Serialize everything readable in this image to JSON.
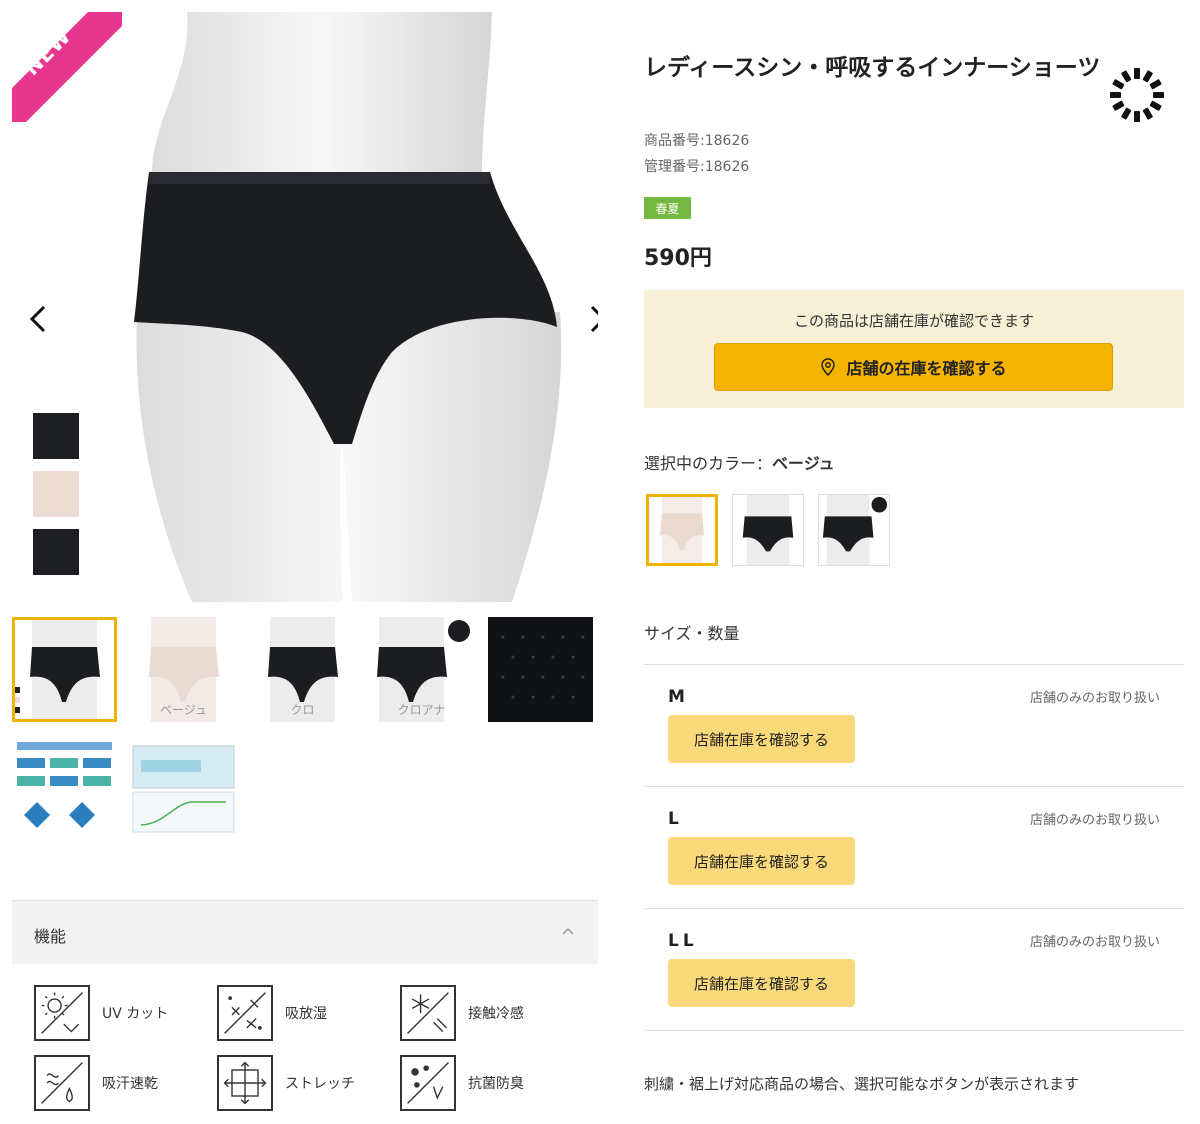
{
  "product": {
    "badge": "NEW",
    "title": "レディースシン・呼吸するインナーショーツ",
    "item_no": "商品番号:18626",
    "mgmt_no": "管理番号:18626",
    "season": "春夏",
    "price": "590円"
  },
  "stock": {
    "message": "この商品は店舗在庫が確認できます",
    "button_label": "店舗の在庫を確認する"
  },
  "color": {
    "label": "選択中のカラー：",
    "selected": "ベージュ",
    "swatches": [
      "#1d1e22",
      "#ecdcd4",
      "#1d1e22"
    ]
  },
  "thumbnails": {
    "captions": [
      "",
      "ベージュ",
      "クロ",
      "クロアナ",
      ""
    ]
  },
  "functions": {
    "title": "機能",
    "items": [
      {
        "label": "UV カット",
        "icon": "uv-cut-icon"
      },
      {
        "label": "吸放湿",
        "icon": "moisture-icon"
      },
      {
        "label": "接触冷感",
        "icon": "cool-touch-icon"
      },
      {
        "label": "吸汗速乾",
        "icon": "quick-dry-icon"
      },
      {
        "label": "ストレッチ",
        "icon": "stretch-icon"
      },
      {
        "label": "抗菌防臭",
        "icon": "antibacterial-icon"
      }
    ]
  },
  "sizes": {
    "title": "サイズ・数量",
    "rows": [
      {
        "name": "M",
        "note": "店舗のみのお取り扱い",
        "button": "店舗在庫を確認する"
      },
      {
        "name": "L",
        "note": "店舗のみのお取り扱い",
        "button": "店舗在庫を確認する"
      },
      {
        "name": "LL",
        "note": "店舗のみのお取り扱い",
        "button": "店舗在庫を確認する"
      }
    ]
  },
  "footer_note": "刺繍・裾上げ対応商品の場合、選択可能なボタンが表示されます",
  "colors": {
    "accent": "#f5b400",
    "selected_border": "#f0b400",
    "badge": "#e8368f",
    "season": "#74b841"
  }
}
